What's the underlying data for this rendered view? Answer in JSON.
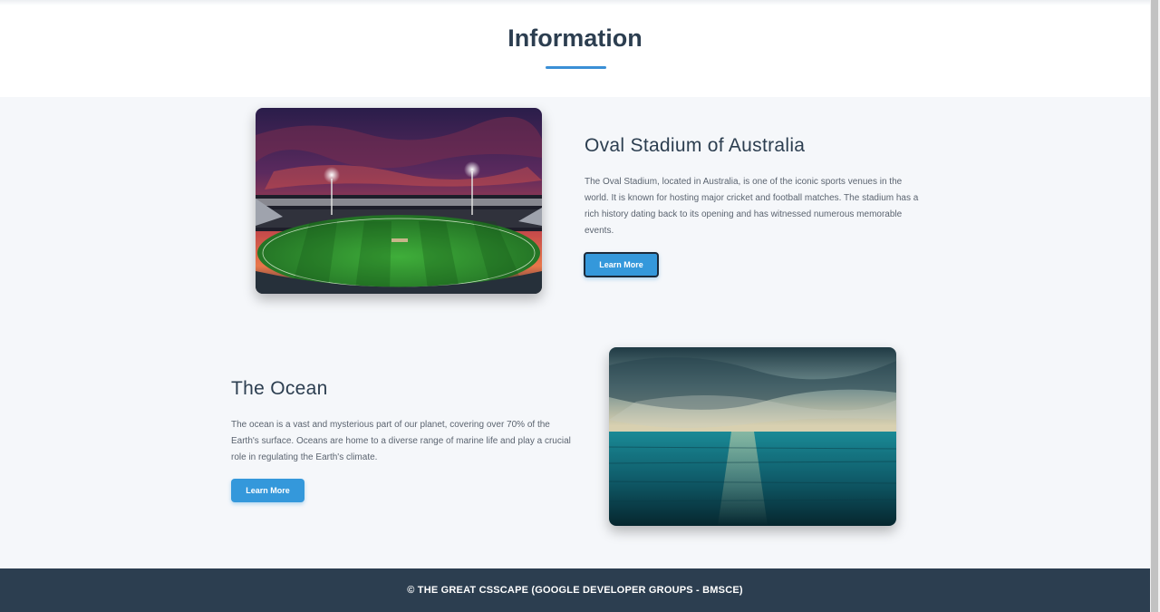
{
  "header": {
    "title": "Information"
  },
  "sections": [
    {
      "title": "Oval Stadium of Australia",
      "text": "The Oval Stadium, located in Australia, is one of the iconic sports venues in the world. It is known for hosting major cricket and football matches. The stadium has a rich history dating back to its opening and has witnessed numerous memorable events.",
      "button_label": "Learn More",
      "image": "stadium-photo"
    },
    {
      "title": "The Ocean",
      "text": "The ocean is a vast and mysterious part of our planet, covering over 70% of the Earth's surface. Oceans are home to a diverse range of marine life and play a crucial role in regulating the Earth's climate.",
      "button_label": "Learn More",
      "image": "ocean-photo"
    }
  ],
  "footer": {
    "text": "© THE GREAT CSSCAPE (GOOGLE DEVELOPER GROUPS - BMSCE)"
  },
  "colors": {
    "accent": "#3498db",
    "heading": "#2c3e50",
    "footer_bg": "#2c3e50",
    "page_bg": "#f5f7fa"
  }
}
